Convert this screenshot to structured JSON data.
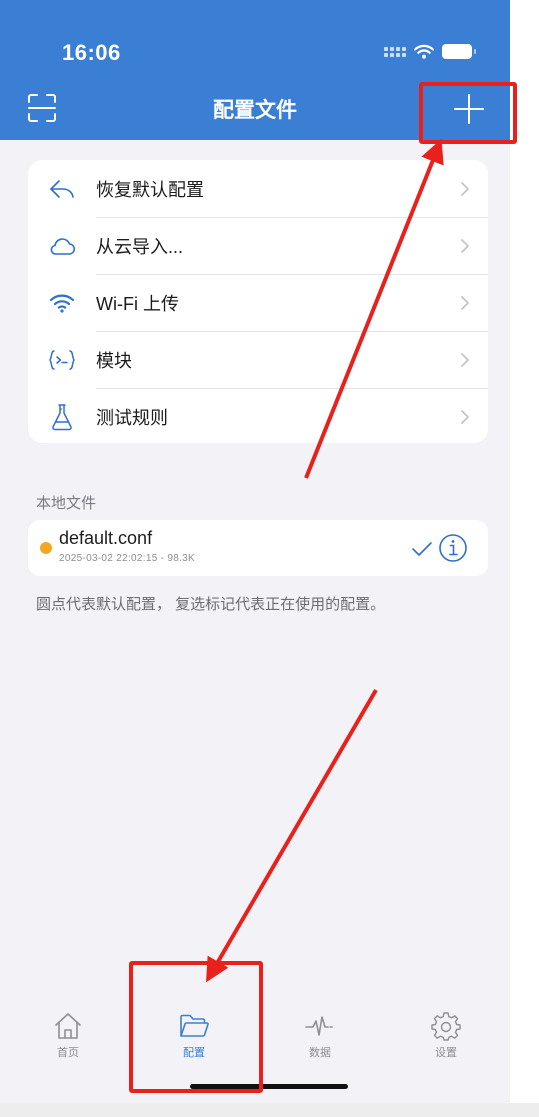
{
  "status": {
    "time": "16:06"
  },
  "header": {
    "title": "配置文件"
  },
  "menu": {
    "items": [
      {
        "label": "恢复默认配置",
        "icon": "undo-arrow-icon"
      },
      {
        "label": "从云导入...",
        "icon": "cloud-icon"
      },
      {
        "label": "Wi-Fi 上传",
        "icon": "wifi-icon"
      },
      {
        "label": "模块",
        "icon": "module-braces-icon"
      },
      {
        "label": "测试规则",
        "icon": "flask-icon"
      }
    ]
  },
  "local_files": {
    "section_label": "本地文件",
    "files": [
      {
        "name": "default.conf",
        "meta": "2025-03-02 22:02:15 - 98.3K",
        "is_default": true,
        "in_use": true
      }
    ],
    "note": "圆点代表默认配置， 复选标记代表正在使用的配置。"
  },
  "tabbar": {
    "tabs": [
      {
        "label": "首页",
        "icon": "home-icon",
        "active": false
      },
      {
        "label": "配置",
        "icon": "folder-icon",
        "active": true
      },
      {
        "label": "数据",
        "icon": "activity-icon",
        "active": false
      },
      {
        "label": "设置",
        "icon": "gear-icon",
        "active": false
      }
    ]
  },
  "colors": {
    "header": "#3b7fd4",
    "accent": "#2f6fcf",
    "default_dot": "#f5a623",
    "annotation": "#e8211c"
  }
}
